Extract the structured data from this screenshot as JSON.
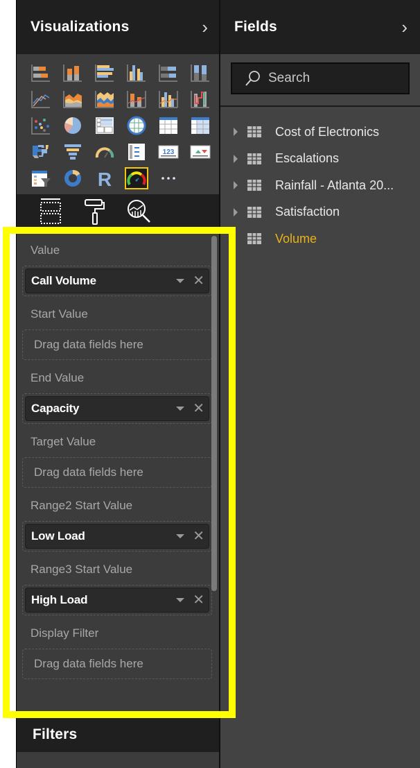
{
  "visualizations": {
    "title": "Visualizations",
    "collapse_icon": "chevron-right-icon",
    "gallery": [
      [
        "stacked-bar-chart",
        "stacked-column-chart",
        "clustered-bar-chart",
        "clustered-column-chart",
        "100-stacked-bar-chart",
        "100-stacked-column-chart"
      ],
      [
        "line-chart",
        "area-chart",
        "stacked-area-chart",
        "line-and-stacked-column-chart",
        "line-and-clustered-column-chart",
        "ribbon-chart"
      ],
      [
        "scatter-chart",
        "pie-chart",
        "treemap",
        "map",
        "table",
        "matrix"
      ],
      [
        "filled-map",
        "funnel",
        "gauge",
        "multi-row-card",
        "card",
        "kpi"
      ],
      [
        "slicer",
        "donut-chart",
        "r-script-visual",
        "custom-gauge",
        "more-visuals"
      ]
    ],
    "selected": "custom-gauge",
    "well_tabs": [
      {
        "name": "fields-tab",
        "icon": "fields-icon"
      },
      {
        "name": "format-tab",
        "icon": "paint-roller-icon"
      },
      {
        "name": "analytics-tab",
        "icon": "analytics-magnifier-icon"
      }
    ],
    "wells": [
      {
        "label": "Value",
        "field": "Call Volume"
      },
      {
        "label": "Start Value",
        "placeholder": "Drag data fields here"
      },
      {
        "label": "End Value",
        "field": "Capacity"
      },
      {
        "label": "Target Value",
        "placeholder": "Drag data fields here"
      },
      {
        "label": "Range2 Start Value",
        "field": "Low Load"
      },
      {
        "label": "Range3 Start Value",
        "field": "High Load"
      },
      {
        "label": "Display Filter",
        "placeholder": "Drag data fields here"
      }
    ]
  },
  "filters": {
    "title": "Filters"
  },
  "fields": {
    "title": "Fields",
    "collapse_icon": "chevron-right-icon",
    "search": {
      "placeholder": "Search",
      "value": ""
    },
    "tables": [
      {
        "label": "Cost of Electronics",
        "active": false
      },
      {
        "label": "Escalations",
        "active": false
      },
      {
        "label": "Rainfall - Atlanta 20...",
        "active": false
      },
      {
        "label": "Satisfaction",
        "active": false
      },
      {
        "label": "Volume",
        "active": true
      }
    ]
  },
  "colors": {
    "accent_yellow": "#f2c811",
    "highlight_box": "#ffff00",
    "active_field": "#e8b21b",
    "pane_dark": "#1f1f1f",
    "pane_mid": "#3c3c3c"
  }
}
